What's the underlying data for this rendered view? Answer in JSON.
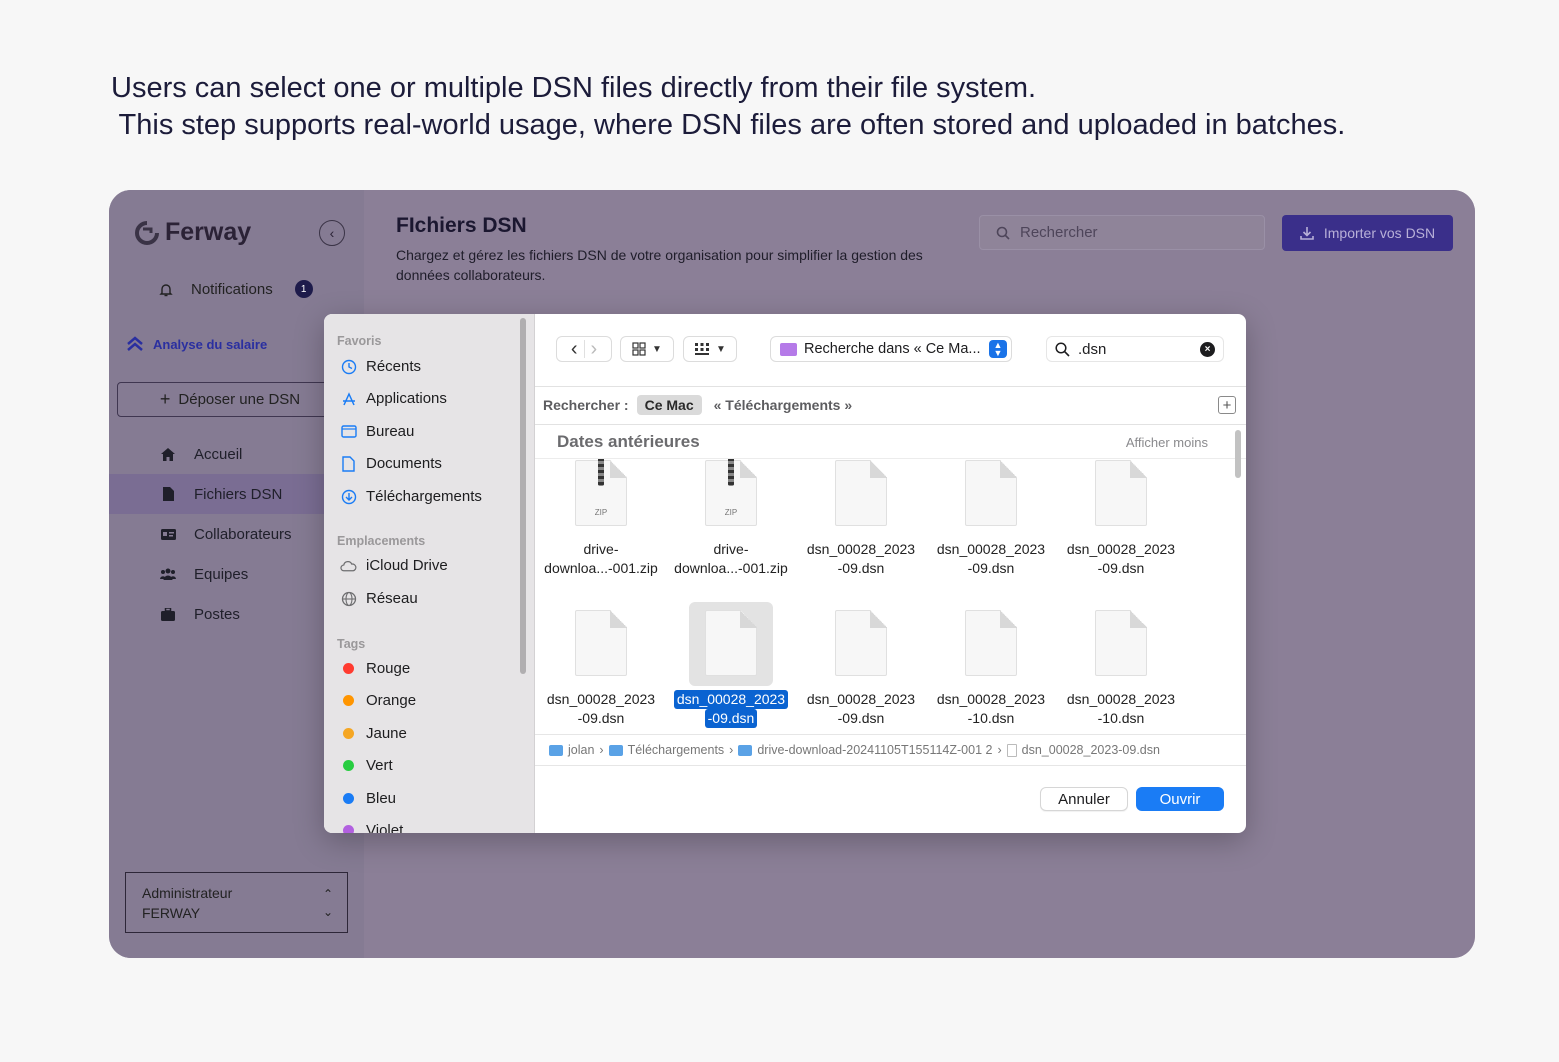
{
  "caption": {
    "line1": "Users can select one or multiple DSN files directly from their file system.",
    "line2": " This step supports real-world usage, where DSN files are often stored and uploaded in batches."
  },
  "app": {
    "brand": "Ferway",
    "notifications": {
      "label": "Notifications",
      "count": "1"
    },
    "section_label": "Analyse du salaire",
    "deposit_button": "Déposer une DSN",
    "nav": [
      {
        "label": "Accueil",
        "icon": "home-icon"
      },
      {
        "label": "Fichiers DSN",
        "icon": "file-icon",
        "active": true
      },
      {
        "label": "Collaborateurs",
        "icon": "id-card-icon"
      },
      {
        "label": "Equipes",
        "icon": "users-icon"
      },
      {
        "label": "Postes",
        "icon": "briefcase-icon"
      }
    ],
    "user": {
      "role": "Administrateur",
      "org": "FERWAY"
    },
    "page": {
      "title": "FIchiers DSN",
      "description": "Chargez et gérez les fichiers DSN de votre organisation pour simplifier la gestion des données collaborateurs.",
      "search_placeholder": "Rechercher",
      "import_button": "Importer vos DSN"
    },
    "colors": {
      "accent": "#3a2f8a",
      "overlay": "#8b7f97",
      "highlight": "#2a2fa0"
    }
  },
  "dialog": {
    "sidebar": {
      "favorites_title": "Favoris",
      "favorites": [
        "Récents",
        "Applications",
        "Bureau",
        "Documents",
        "Téléchargements"
      ],
      "locations_title": "Emplacements",
      "locations": [
        "iCloud Drive",
        "Réseau"
      ],
      "tags_title": "Tags",
      "tags": [
        {
          "label": "Rouge",
          "color": "#ff3b30"
        },
        {
          "label": "Orange",
          "color": "#ff9500"
        },
        {
          "label": "Jaune",
          "color": "#f5a623"
        },
        {
          "label": "Vert",
          "color": "#28cd41"
        },
        {
          "label": "Bleu",
          "color": "#1a7cf5"
        },
        {
          "label": "Violet",
          "color": "#b260e0"
        }
      ]
    },
    "toolbar": {
      "location": "Recherche dans « Ce Ma...",
      "search_value": ".dsn"
    },
    "scope": {
      "label": "Rechercher :",
      "this_mac": "Ce Mac",
      "folder": "« Téléchargements »"
    },
    "group": {
      "title": "Dates antérieures",
      "toggle": "Afficher moins"
    },
    "files": [
      {
        "line1": "drive-",
        "line2": "downloa...-001.zip",
        "type": "zip",
        "zip_label": "ZIP"
      },
      {
        "line1": "drive-",
        "line2": "downloa...-001.zip",
        "type": "zip",
        "zip_label": "ZIP"
      },
      {
        "line1": "dsn_00028_2023",
        "line2": "-09.dsn",
        "type": "doc"
      },
      {
        "line1": "dsn_00028_2023",
        "line2": "-09.dsn",
        "type": "doc"
      },
      {
        "line1": "dsn_00028_2023",
        "line2": "-09.dsn",
        "type": "doc"
      },
      {
        "line1": "dsn_00028_2023",
        "line2": "-09.dsn",
        "type": "doc"
      },
      {
        "line1": "dsn_00028_2023",
        "line2": "-09.dsn",
        "type": "doc",
        "selected": true
      },
      {
        "line1": "dsn_00028_2023",
        "line2": "-09.dsn",
        "type": "doc"
      },
      {
        "line1": "dsn_00028_2023",
        "line2": "-10.dsn",
        "type": "doc"
      },
      {
        "line1": "dsn_00028_2023",
        "line2": "-10.dsn",
        "type": "doc"
      }
    ],
    "path": [
      "jolan",
      "Téléchargements",
      "drive-download-20241105T155114Z-001 2",
      "dsn_00028_2023-09.dsn"
    ],
    "cancel_button": "Annuler",
    "open_button": "Ouvrir"
  }
}
